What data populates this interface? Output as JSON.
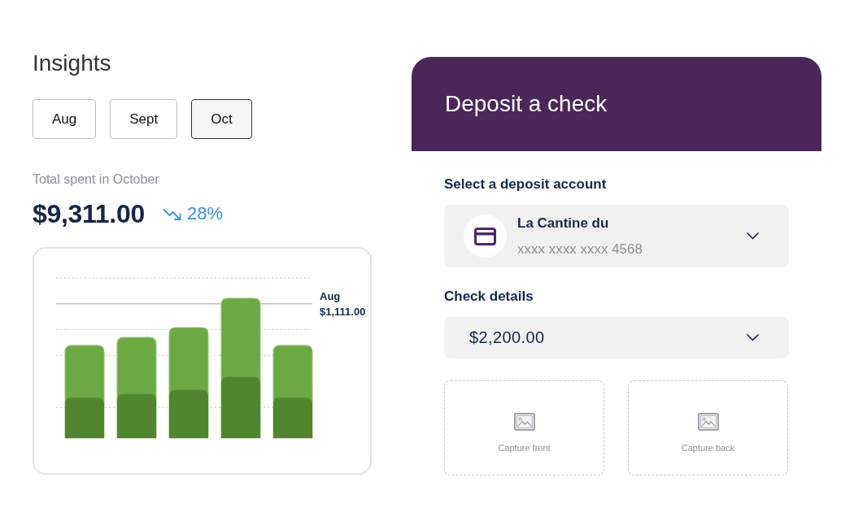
{
  "insights": {
    "title": "Insights",
    "months": [
      {
        "label": "Aug",
        "selected": false
      },
      {
        "label": "Sept",
        "selected": false
      },
      {
        "label": "Oct",
        "selected": true
      }
    ],
    "total_label": "Total spent in October",
    "total_amount": "$9,311.00",
    "change": {
      "text": "28%"
    },
    "chart": {
      "callout_label": "Aug",
      "callout_amount": "$1,111.00"
    }
  },
  "deposit": {
    "title": "Deposit a check",
    "account_label": "Select a deposit account",
    "account": {
      "name": "La Cantine du",
      "number": "xxxx xxxx xxxx 4568"
    },
    "details_label": "Check details",
    "amount": "$2,200.00",
    "captures": [
      {
        "label": "Capture front"
      },
      {
        "label": "Capture back"
      }
    ]
  }
}
